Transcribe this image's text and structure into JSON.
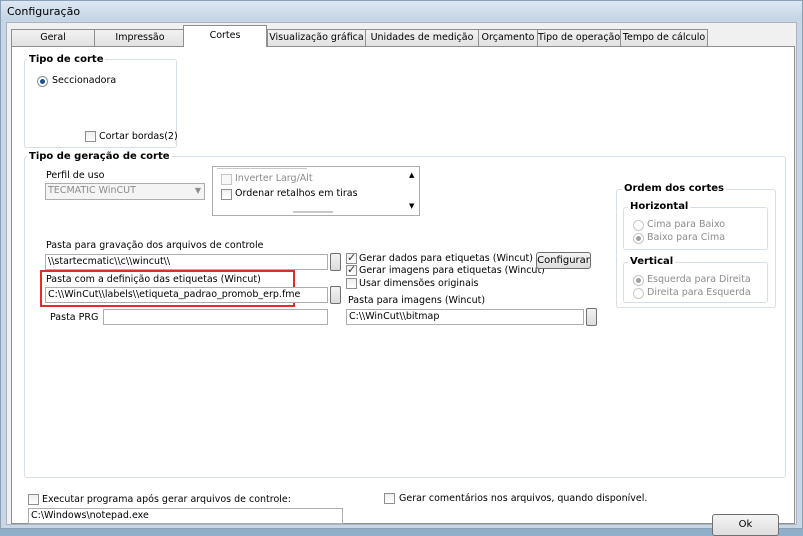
{
  "window": {
    "title": "Configuração"
  },
  "tabs": [
    {
      "label": "Geral"
    },
    {
      "label": "Impressão"
    },
    {
      "label": "Cortes"
    },
    {
      "label": "Visualização gráfica"
    },
    {
      "label": "Unidades de medição"
    },
    {
      "label": "Orçamento"
    },
    {
      "label": "Tipo de operação"
    },
    {
      "label": "Tempo de cálculo"
    }
  ],
  "tipo_corte": {
    "legend": "Tipo de corte",
    "seccionadora_label": "Seccionadora",
    "cortar_bordas_label": "Cortar bordas(2)"
  },
  "geracao": {
    "legend": "Tipo de geração de corte",
    "perfil_label": "Perfil de uso",
    "perfil_value": "TECMATIC WinCUT",
    "inverter_label": "Inverter Larg/Alt",
    "ordenar_label": "Ordenar retalhos em tiras",
    "pasta_gravacao_label": "Pasta para gravação dos arquivos de controle",
    "pasta_gravacao_value": "\\\\startecmatic\\\\c\\\\wincut\\\\",
    "gerar_dados_label": "Gerar dados para etiquetas (Wincut)",
    "gerar_imagens_label": "Gerar imagens para etiquetas  (Wincut)",
    "configurar_label": "Configurar",
    "pasta_definicao_label": "Pasta com a definição das etiquetas (Wincut)",
    "pasta_definicao_value": "C:\\\\WinCut\\\\labels\\\\etiqueta_padrao_promob_erp.fme",
    "usar_dimensoes_label": "Usar dimensões originais",
    "pasta_imagens_label": "Pasta para imagens (Wincut)",
    "pasta_imagens_value": "C:\\\\WinCut\\\\bitmap",
    "pasta_prg_label": "Pasta PRG",
    "pasta_prg_value": ""
  },
  "ordem": {
    "legend": "Ordem dos cortes",
    "horizontal_legend": "Horizontal",
    "cima_baixo": "Cima para Baixo",
    "baixo_cima": "Baixo para Cima",
    "vertical_legend": "Vertical",
    "esq_dir": "Esquerda para Direita",
    "dir_esq": "Direita para Esquerda"
  },
  "bottom": {
    "executar_label": "Executar programa após gerar arquivos de controle:",
    "executar_value": "C:\\Windows\\notepad.exe",
    "gerar_comentarios_label": "Gerar comentários nos arquivos, quando disponível.",
    "ok_label": "Ok"
  }
}
